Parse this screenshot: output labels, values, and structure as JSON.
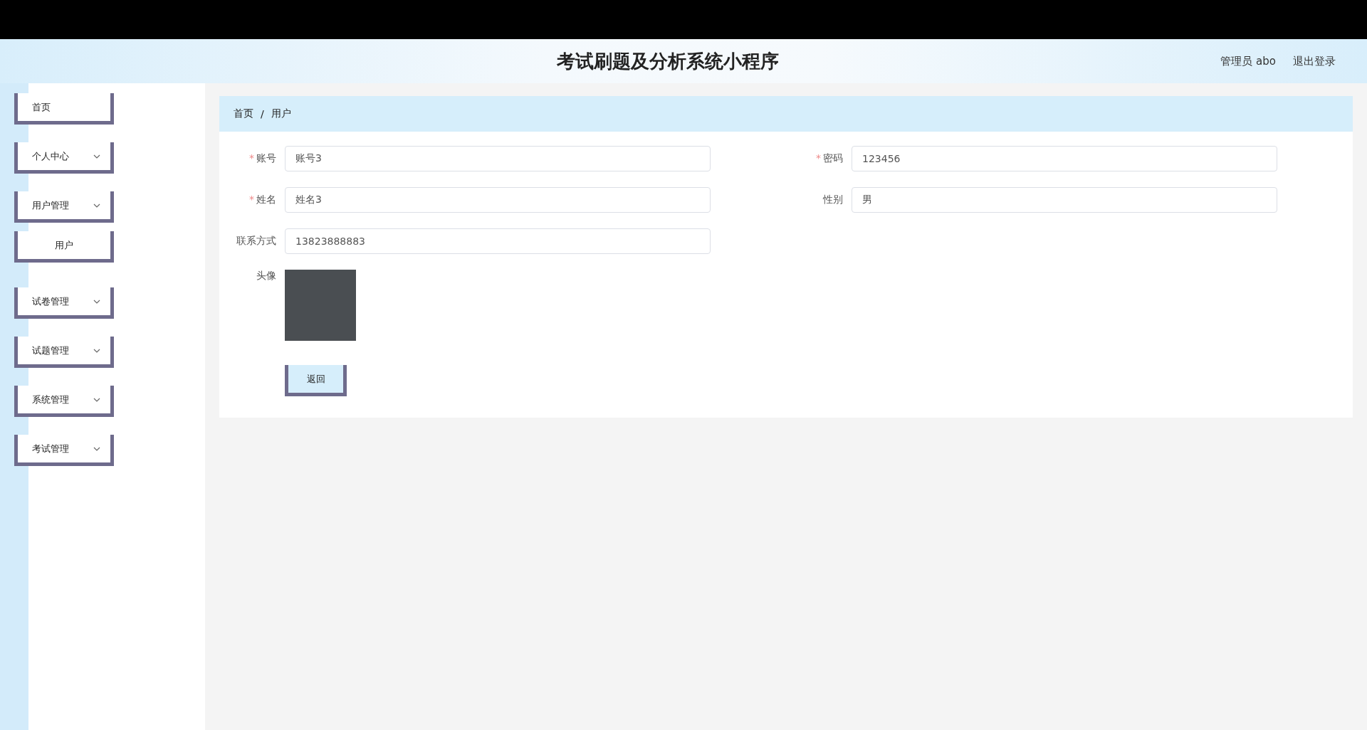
{
  "header": {
    "title": "考试刷题及分析系统小程序",
    "user": "管理员 abo",
    "logout": "退出登录"
  },
  "sidebar": {
    "items": [
      {
        "label": "首页",
        "kind": "link"
      },
      {
        "label": "个人中心",
        "kind": "submenu"
      },
      {
        "label": "用户管理",
        "kind": "submenu",
        "children": [
          {
            "label": "用户"
          }
        ]
      },
      {
        "label": "试卷管理",
        "kind": "submenu"
      },
      {
        "label": "试题管理",
        "kind": "submenu"
      },
      {
        "label": "系统管理",
        "kind": "submenu"
      },
      {
        "label": "考试管理",
        "kind": "submenu"
      }
    ]
  },
  "breadcrumb": {
    "items": [
      "首页",
      "用户"
    ],
    "separator": "/"
  },
  "form": {
    "fields": [
      {
        "label": "账号",
        "kind": "input",
        "required_mark": "*",
        "value": "账号3"
      },
      {
        "label": "密码",
        "kind": "input",
        "required_mark": "*",
        "value": "123456"
      },
      {
        "label": "姓名",
        "kind": "input",
        "required_mark": "*",
        "value": "姓名3"
      },
      {
        "label": "性别",
        "kind": "input",
        "value": "男"
      },
      {
        "label": "联系方式",
        "kind": "input",
        "value": "13823888883"
      },
      {
        "label": "头像",
        "kind": "image"
      }
    ],
    "button": "返回"
  }
}
